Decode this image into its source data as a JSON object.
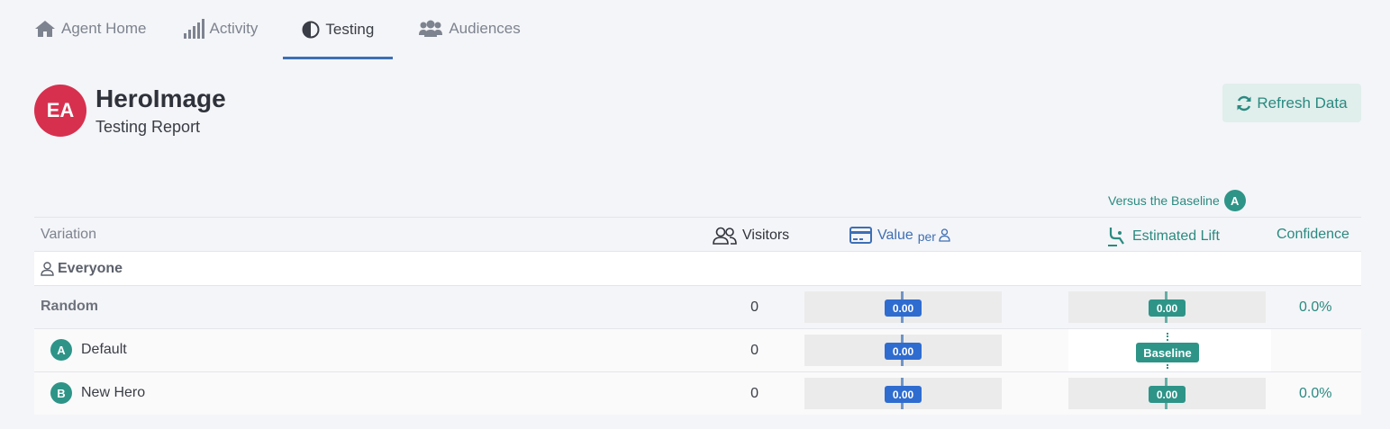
{
  "nav": {
    "tabs": [
      {
        "label": "Agent Home",
        "icon": "home-icon"
      },
      {
        "label": "Activity",
        "icon": "signal-bars-icon"
      },
      {
        "label": "Testing",
        "icon": "half-circle-icon",
        "active": true
      },
      {
        "label": "Audiences",
        "icon": "users-icon"
      }
    ]
  },
  "header": {
    "avatar_initials": "EA",
    "avatar_color": "#d7304f",
    "agent_name": "HeroImage",
    "subtitle": "Testing Report",
    "refresh_label": "Refresh Data"
  },
  "comparison_note": {
    "label": "Versus the Baseline",
    "baseline_badge": "A"
  },
  "table": {
    "columns": {
      "variation": "Variation",
      "visitors": "Visitors",
      "value": "Value",
      "value_per": "per",
      "estimated_lift": "Estimated Lift",
      "confidence": "Confidence"
    },
    "group": "Everyone",
    "rows": [
      {
        "name": "Random",
        "visitors": "0",
        "value": "0.00",
        "lift": "0.00",
        "confidence": "0.0%"
      },
      {
        "badge": "A",
        "name": "Default",
        "visitors": "0",
        "value": "0.00",
        "lift_label": "Baseline"
      },
      {
        "badge": "B",
        "name": "New Hero",
        "visitors": "0",
        "value": "0.00",
        "lift": "0.00",
        "confidence": "0.0%"
      }
    ]
  },
  "colors": {
    "accent_blue": "#3d6fb5",
    "accent_teal": "#2e9488"
  }
}
